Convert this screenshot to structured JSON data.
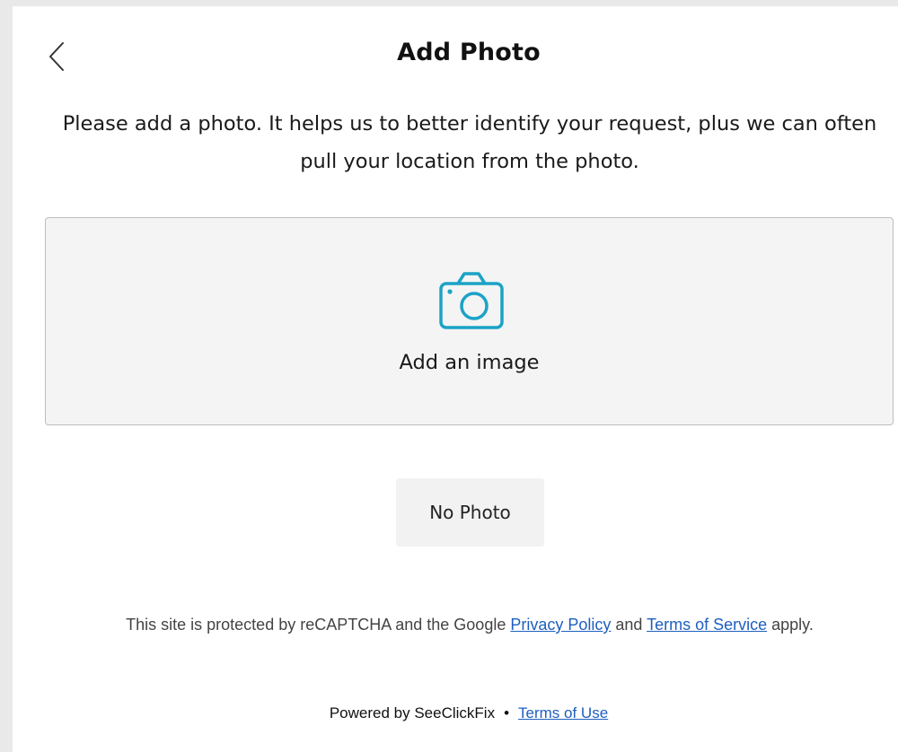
{
  "header": {
    "back_icon": "chevron-left-icon",
    "title": "Add Photo"
  },
  "intro": {
    "text": "Please add a photo. It helps us to better identify your request, plus we can often pull your location from the photo."
  },
  "dropzone": {
    "icon": "camera-icon",
    "icon_color": "#1ba3c6",
    "label": "Add an image"
  },
  "no_photo_button": {
    "label": "No Photo"
  },
  "recaptcha": {
    "text_before": "This site is protected by reCAPTCHA and the Google ",
    "privacy_link": "Privacy Policy",
    "text_and": " and ",
    "terms_link": "Terms of Service",
    "text_after": " apply."
  },
  "footer": {
    "powered_by": "Powered by SeeClickFix",
    "separator": "•",
    "terms_of_use_link": "Terms of Use"
  },
  "colors": {
    "link": "#1e5fbf",
    "accent": "#1ba3c6",
    "dropzone_bg": "#f4f4f4",
    "button_bg": "#f2f2f2"
  }
}
